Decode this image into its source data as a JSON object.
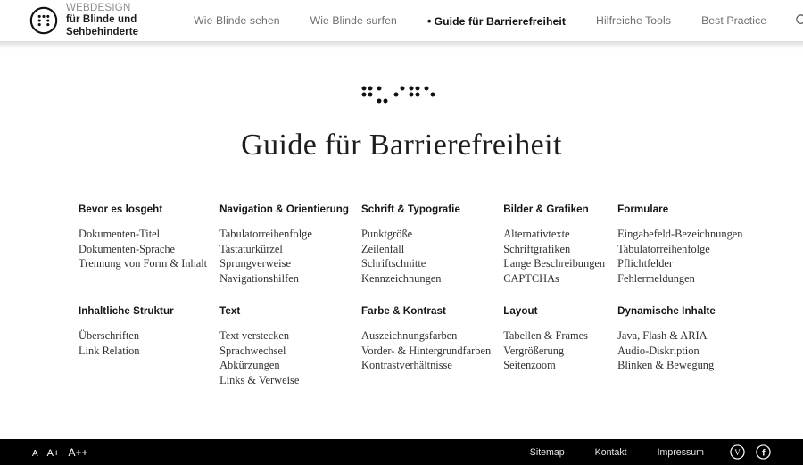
{
  "header": {
    "brand": {
      "logo_icon": "braille-circle-logo",
      "line1": "WEBDESIGN",
      "line2": "für Blinde und Sehbehinderte"
    },
    "nav": [
      {
        "label": "Wie Blinde sehen",
        "active": false
      },
      {
        "label": "Wie Blinde surfen",
        "active": false
      },
      {
        "label": "Guide für Barrierefreiheit",
        "active": true,
        "bullet": "•"
      },
      {
        "label": "Hilfreiche Tools",
        "active": false
      },
      {
        "label": "Best Practice",
        "active": false
      }
    ],
    "search_icon": "search-icon"
  },
  "main": {
    "braille_decoration": "braille-dots-decoration",
    "title": "Guide für Barrierefreiheit",
    "columns": [
      {
        "heading": "Bevor es losgeht",
        "links": [
          "Dokumenten-Titel",
          "Dokumenten-Sprache",
          "Trennung von Form & Inhalt"
        ]
      },
      {
        "heading": "Navigation & Orientierung",
        "links": [
          "Tabulatorreihenfolge",
          "Tastaturkürzel",
          "Sprungverweise",
          "Navigationshilfen"
        ]
      },
      {
        "heading": "Schrift & Typografie",
        "links": [
          "Punktgröße",
          "Zeilenfall",
          "Schriftschnitte",
          "Kennzeichnungen"
        ]
      },
      {
        "heading": "Bilder & Grafiken",
        "links": [
          "Alternativtexte",
          "Schriftgrafiken",
          "Lange Beschreibungen",
          "CAPTCHAs"
        ]
      },
      {
        "heading": "Formulare",
        "links": [
          "Eingabefeld-Bezeichnungen",
          "Tabulatorreihenfolge",
          "Pflichtfelder",
          "Fehlermeldungen"
        ]
      },
      {
        "heading": "Inhaltliche Struktur",
        "links": [
          "Überschriften",
          "Link Relation"
        ]
      },
      {
        "heading": "Text",
        "links": [
          "Text verstecken",
          "Sprachwechsel",
          "Abkürzungen",
          "Links & Verweise"
        ]
      },
      {
        "heading": "Farbe & Kontrast",
        "links": [
          "Auszeichnungsfarben",
          "Vorder- & Hintergrundfarben",
          "Kontrastverhältnisse"
        ]
      },
      {
        "heading": "Layout",
        "links": [
          "Tabellen & Frames",
          "Vergrößerung",
          "Seitenzoom"
        ]
      },
      {
        "heading": "Dynamische Inhalte",
        "links": [
          "Java, Flash & ARIA",
          "Audio-Diskription",
          "Blinken & Bewegung"
        ]
      }
    ]
  },
  "footer": {
    "fontsize": [
      {
        "label": "A",
        "name": "font-size-small"
      },
      {
        "label": "A+",
        "name": "font-size-medium"
      },
      {
        "label": "A++",
        "name": "font-size-large"
      }
    ],
    "links": [
      "Sitemap",
      "Kontakt",
      "Impressum"
    ],
    "social": [
      {
        "name": "vimeo-icon",
        "glyph": "V"
      },
      {
        "name": "facebook-icon",
        "glyph": "f"
      }
    ]
  },
  "colors": {
    "background": "#ffffff",
    "footer_bg": "#000000",
    "text": "#222222",
    "nav_inactive": "#6e6e6e",
    "nav_active": "#111111"
  }
}
